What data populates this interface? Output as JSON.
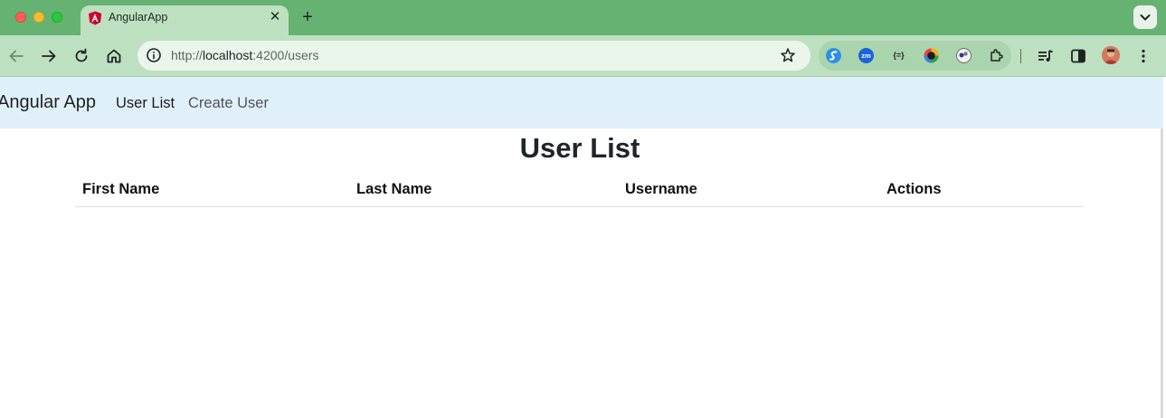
{
  "browser": {
    "tab": {
      "title": "AngularApp",
      "close_symbol": "✕"
    },
    "new_tab_symbol": "+",
    "address": {
      "scheme": "http://",
      "host": "localhost",
      "rest": ":4200/users"
    }
  },
  "app": {
    "brand": "Angular App",
    "nav": [
      {
        "label": "User List",
        "active": true
      },
      {
        "label": "Create User",
        "active": false
      }
    ],
    "page_title": "User List",
    "table": {
      "columns": [
        "First Name",
        "Last Name",
        "Username",
        "Actions"
      ],
      "rows": []
    }
  },
  "colors": {
    "tabstrip": "#66b272",
    "toolbar": "#bde0c1",
    "navbar": "#dff0fb",
    "angular_red": "#dd0031"
  },
  "icons": [
    "back-arrow-icon",
    "forward-arrow-icon",
    "reload-icon",
    "home-icon",
    "site-info-icon",
    "bookmark-star-icon",
    "extensions-puzzle-icon",
    "media-controls-icon",
    "side-panel-icon",
    "menu-kebab-icon"
  ]
}
